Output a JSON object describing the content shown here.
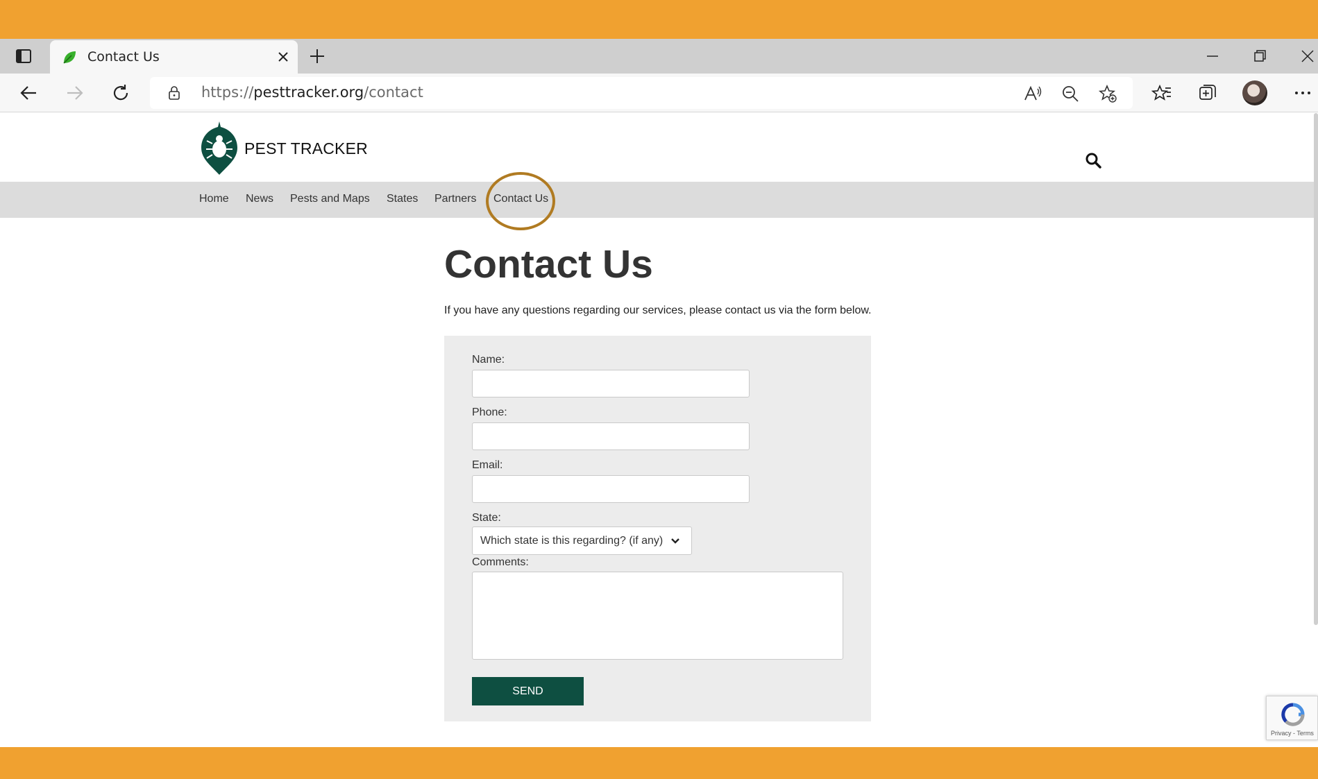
{
  "browser": {
    "tab_title": "Contact Us",
    "url_prefix": "https://",
    "url_host": "pesttracker.org",
    "url_path": "/contact"
  },
  "site": {
    "logo_text": "PEST TRACKER",
    "menu": [
      "Home",
      "News",
      "Pests and Maps",
      "States",
      "Partners",
      "Contact Us"
    ],
    "highlighted_menu_item": "Contact Us"
  },
  "content": {
    "heading": "Contact Us",
    "intro": "If you have any questions regarding our services, please contact us via the form below."
  },
  "form": {
    "name_label": "Name:",
    "phone_label": "Phone:",
    "email_label": "Email:",
    "state_label": "State:",
    "state_selected": "Which state is this regarding? (if any)",
    "comments_label": "Comments:",
    "send_label": "SEND"
  },
  "recaptcha": {
    "footer": "Privacy - Terms"
  },
  "colors": {
    "accent_orange": "#f0a130",
    "brand_green": "#0e4f41",
    "annotation_circle": "#b07b22"
  }
}
